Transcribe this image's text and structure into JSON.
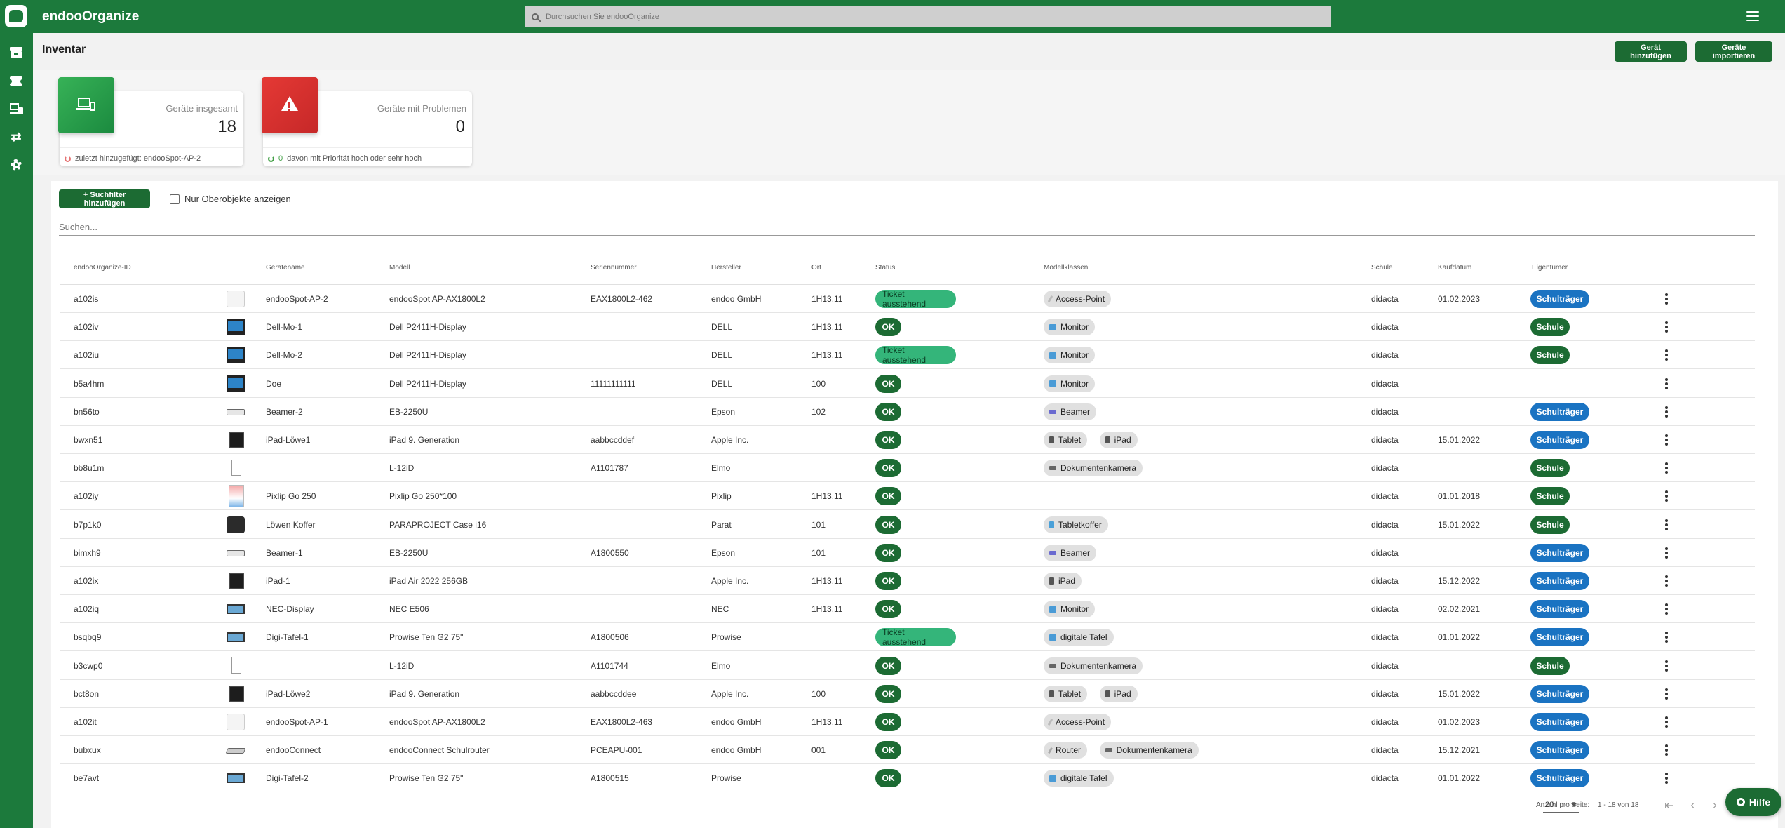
{
  "app": {
    "title": "endooOrganize",
    "search_placeholder": "Durchsuchen Sie endooOrganize"
  },
  "sidebar": {
    "icons": [
      "archive-icon",
      "ticket-icon",
      "devices-icon",
      "swap-icon",
      "gear-icon"
    ]
  },
  "page": {
    "title": "Inventar",
    "add_button": "Gerät hinzufügen",
    "import_button": "Geräte importieren"
  },
  "stats": {
    "total": {
      "label": "Geräte insgesamt",
      "value": "18",
      "footer": "zuletzt hinzugefügt: endooSpot-AP-2"
    },
    "problems": {
      "label": "Geräte mit Problemen",
      "value": "0",
      "footer_count": "0",
      "footer": "davon mit Priorität hoch oder sehr hoch"
    }
  },
  "filters": {
    "add_filter": "+ Suchfilter hinzufügen",
    "only_parents": "Nur Oberobjekte anzeigen",
    "search_placeholder": "Suchen..."
  },
  "table": {
    "headers": {
      "id": "endooOrganize-ID",
      "name": "Gerätename",
      "model": "Modell",
      "serial": "Seriennummer",
      "maker": "Hersteller",
      "place": "Ort",
      "status": "Status",
      "classes": "Modellklassen",
      "school": "Schule",
      "date": "Kaufdatum",
      "owner": "Eigentümer"
    },
    "rows": [
      {
        "id": "a102is",
        "thumb": "ap",
        "name": "endooSpot-AP-2",
        "model": "endooSpot AP-AX1800L2",
        "serial": "EAX1800L2-462",
        "maker": "endoo GmbH",
        "place": "1H13.11",
        "status": "Ticket ausstehend",
        "classes": [
          {
            "label": "Access-Point",
            "icon": "ap"
          }
        ],
        "school": "didacta",
        "date": "01.02.2023",
        "owner": "Schulträger"
      },
      {
        "id": "a102iv",
        "thumb": "mon",
        "name": "Dell-Mo-1",
        "model": "Dell P2411H-Display",
        "serial": "",
        "maker": "DELL",
        "place": "1H13.11",
        "status": "OK",
        "classes": [
          {
            "label": "Monitor",
            "icon": "mon"
          }
        ],
        "school": "didacta",
        "date": "",
        "owner": "Schule"
      },
      {
        "id": "a102iu",
        "thumb": "mon",
        "name": "Dell-Mo-2",
        "model": "Dell P2411H-Display",
        "serial": "",
        "maker": "DELL",
        "place": "1H13.11",
        "status": "Ticket ausstehend",
        "classes": [
          {
            "label": "Monitor",
            "icon": "mon"
          }
        ],
        "school": "didacta",
        "date": "",
        "owner": "Schule"
      },
      {
        "id": "b5a4hm",
        "thumb": "mon",
        "name": "Doe",
        "model": "Dell P2411H-Display",
        "serial": "11111111111",
        "maker": "DELL",
        "place": "100",
        "status": "OK",
        "classes": [
          {
            "label": "Monitor",
            "icon": "mon"
          }
        ],
        "school": "didacta",
        "date": "",
        "owner": ""
      },
      {
        "id": "bn56to",
        "thumb": "beam",
        "name": "Beamer-2",
        "model": "EB-2250U",
        "serial": "",
        "maker": "Epson",
        "place": "102",
        "status": "OK",
        "classes": [
          {
            "label": "Beamer",
            "icon": "beam"
          }
        ],
        "school": "didacta",
        "date": "",
        "owner": "Schulträger"
      },
      {
        "id": "bwxn51",
        "thumb": "ipad",
        "name": "iPad-Löwe1",
        "model": "iPad 9. Generation",
        "serial": "aabbccddef",
        "maker": "Apple Inc.",
        "place": "",
        "status": "OK",
        "classes": [
          {
            "label": "Tablet",
            "icon": "tab"
          },
          {
            "label": "iPad",
            "icon": "tab"
          }
        ],
        "school": "didacta",
        "date": "15.01.2022",
        "owner": "Schulträger"
      },
      {
        "id": "bb8u1m",
        "thumb": "cam",
        "name": "",
        "model": "L-12iD",
        "serial": "A1101787",
        "maker": "Elmo",
        "place": "",
        "status": "OK",
        "classes": [
          {
            "label": "Dokumentenkamera",
            "icon": "cam"
          }
        ],
        "school": "didacta",
        "date": "",
        "owner": "Schule"
      },
      {
        "id": "a102iy",
        "thumb": "pix",
        "name": "Pixlip Go 250",
        "model": "Pixlip Go 250*100",
        "serial": "",
        "maker": "Pixlip",
        "place": "1H13.11",
        "status": "OK",
        "classes": [],
        "school": "didacta",
        "date": "01.01.2018",
        "owner": "Schule"
      },
      {
        "id": "b7p1k0",
        "thumb": "case",
        "name": "Löwen Koffer",
        "model": "PARAPROJECT Case i16",
        "serial": "",
        "maker": "Parat",
        "place": "101",
        "status": "OK",
        "classes": [
          {
            "label": "Tabletkoffer",
            "icon": "koffer"
          }
        ],
        "school": "didacta",
        "date": "15.01.2022",
        "owner": "Schule"
      },
      {
        "id": "bimxh9",
        "thumb": "beam",
        "name": "Beamer-1",
        "model": "EB-2250U",
        "serial": "A1800550",
        "maker": "Epson",
        "place": "101",
        "status": "OK",
        "classes": [
          {
            "label": "Beamer",
            "icon": "beam"
          }
        ],
        "school": "didacta",
        "date": "",
        "owner": "Schulträger"
      },
      {
        "id": "a102ix",
        "thumb": "ipad",
        "name": "iPad-1",
        "model": "iPad Air 2022 256GB",
        "serial": "",
        "maker": "Apple Inc.",
        "place": "1H13.11",
        "status": "OK",
        "classes": [
          {
            "label": "iPad",
            "icon": "tab"
          }
        ],
        "school": "didacta",
        "date": "15.12.2022",
        "owner": "Schulträger"
      },
      {
        "id": "a102iq",
        "thumb": "tafel",
        "name": "NEC-Display",
        "model": "NEC E506",
        "serial": "",
        "maker": "NEC",
        "place": "1H13.11",
        "status": "OK",
        "classes": [
          {
            "label": "Monitor",
            "icon": "mon"
          }
        ],
        "school": "didacta",
        "date": "02.02.2021",
        "owner": "Schulträger"
      },
      {
        "id": "bsqbq9",
        "thumb": "tafel",
        "name": "Digi-Tafel-1",
        "model": "Prowise Ten G2 75\"",
        "serial": "A1800506",
        "maker": "Prowise",
        "place": "",
        "status": "Ticket ausstehend",
        "classes": [
          {
            "label": "digitale Tafel",
            "icon": "tafel"
          }
        ],
        "school": "didacta",
        "date": "01.01.2022",
        "owner": "Schulträger"
      },
      {
        "id": "b3cwp0",
        "thumb": "cam",
        "name": "",
        "model": "L-12iD",
        "serial": "A1101744",
        "maker": "Elmo",
        "place": "",
        "status": "OK",
        "classes": [
          {
            "label": "Dokumentenkamera",
            "icon": "cam"
          }
        ],
        "school": "didacta",
        "date": "",
        "owner": "Schule"
      },
      {
        "id": "bct8on",
        "thumb": "ipad",
        "name": "iPad-Löwe2",
        "model": "iPad 9. Generation",
        "serial": "aabbccddee",
        "maker": "Apple Inc.",
        "place": "100",
        "status": "OK",
        "classes": [
          {
            "label": "Tablet",
            "icon": "tab"
          },
          {
            "label": "iPad",
            "icon": "tab"
          }
        ],
        "school": "didacta",
        "date": "15.01.2022",
        "owner": "Schulträger"
      },
      {
        "id": "a102it",
        "thumb": "ap",
        "name": "endooSpot-AP-1",
        "model": "endooSpot AP-AX1800L2",
        "serial": "EAX1800L2-463",
        "maker": "endoo GmbH",
        "place": "1H13.11",
        "status": "OK",
        "classes": [
          {
            "label": "Access-Point",
            "icon": "ap"
          }
        ],
        "school": "didacta",
        "date": "01.02.2023",
        "owner": "Schulträger"
      },
      {
        "id": "bubxux",
        "thumb": "router",
        "name": "endooConnect",
        "model": "endooConnect Schulrouter",
        "serial": "PCEAPU-001",
        "maker": "endoo GmbH",
        "place": "001",
        "status": "OK",
        "classes": [
          {
            "label": "Router",
            "icon": "router"
          },
          {
            "label": "Dokumentenkamera",
            "icon": "cam"
          }
        ],
        "school": "didacta",
        "date": "15.12.2021",
        "owner": "Schulträger"
      },
      {
        "id": "be7avt",
        "thumb": "tafel",
        "name": "Digi-Tafel-2",
        "model": "Prowise Ten G2 75\"",
        "serial": "A1800515",
        "maker": "Prowise",
        "place": "",
        "status": "OK",
        "classes": [
          {
            "label": "digitale Tafel",
            "icon": "tafel"
          }
        ],
        "school": "didacta",
        "date": "01.01.2022",
        "owner": "Schulträger"
      }
    ]
  },
  "pagination": {
    "per_page_label": "Anzahl pro Seite:",
    "per_page": "20",
    "range": "1 - 18 von 18"
  },
  "help": {
    "label": "Hilfe"
  }
}
